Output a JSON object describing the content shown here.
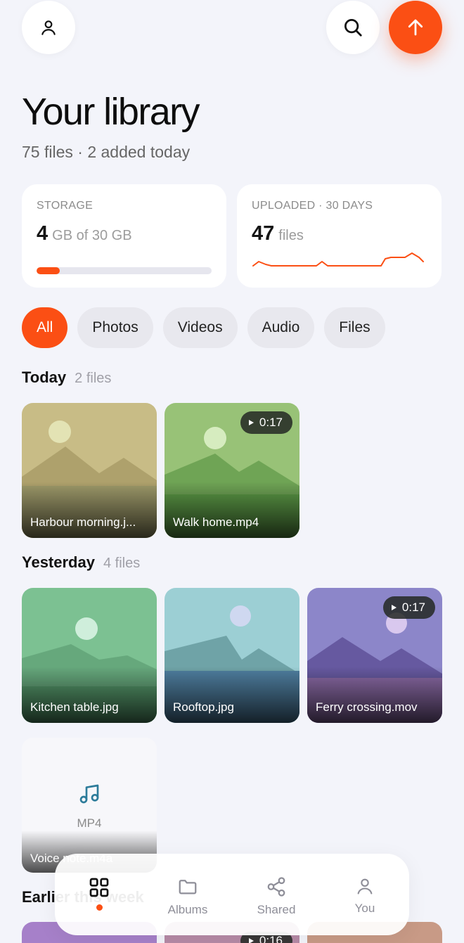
{
  "header": {
    "profile_icon": "person-icon",
    "search_icon": "search-icon",
    "upload_icon": "arrow-up-icon",
    "title": "Your library",
    "subtitle": "75 files · 2 added today"
  },
  "storage_card": {
    "label": "STORAGE",
    "value": "4",
    "unit": "GB of 30 GB",
    "used_fraction": 0.133
  },
  "upload_card": {
    "label": "UPLOADED · 30 DAYS",
    "value": "47",
    "unit": "files"
  },
  "filters": [
    "All",
    "Photos",
    "Videos",
    "Audio",
    "Files"
  ],
  "active_filter": "All",
  "sections": {
    "today": {
      "title": "Today",
      "count": "2 files",
      "items": [
        {
          "name": "Harbour morning.j...",
          "duration": ""
        },
        {
          "name": "Walk home.mp4",
          "duration": "0:17"
        }
      ]
    },
    "yesterday": {
      "title": "Yesterday",
      "count": "4 files",
      "items": [
        {
          "name": "Kitchen table.jpg",
          "duration": ""
        },
        {
          "name": "Rooftop.jpg",
          "duration": ""
        },
        {
          "name": "Ferry crossing.mov",
          "duration": "0:17"
        },
        {
          "name": "Voice note.m4a",
          "type_label": "MP4",
          "icon": "music-note-icon"
        }
      ]
    },
    "earlier": {
      "title": "Earlier this week",
      "peek_duration": "0:16"
    }
  },
  "tabbar": {
    "items": [
      {
        "label": "",
        "icon": "grid-icon",
        "active": true
      },
      {
        "label": "Albums",
        "icon": "folder-icon"
      },
      {
        "label": "Shared",
        "icon": "share-icon"
      },
      {
        "label": "You",
        "icon": "person-icon"
      }
    ]
  },
  "colors": {
    "accent": "#fb4f14",
    "background": "#f3f4fa"
  }
}
